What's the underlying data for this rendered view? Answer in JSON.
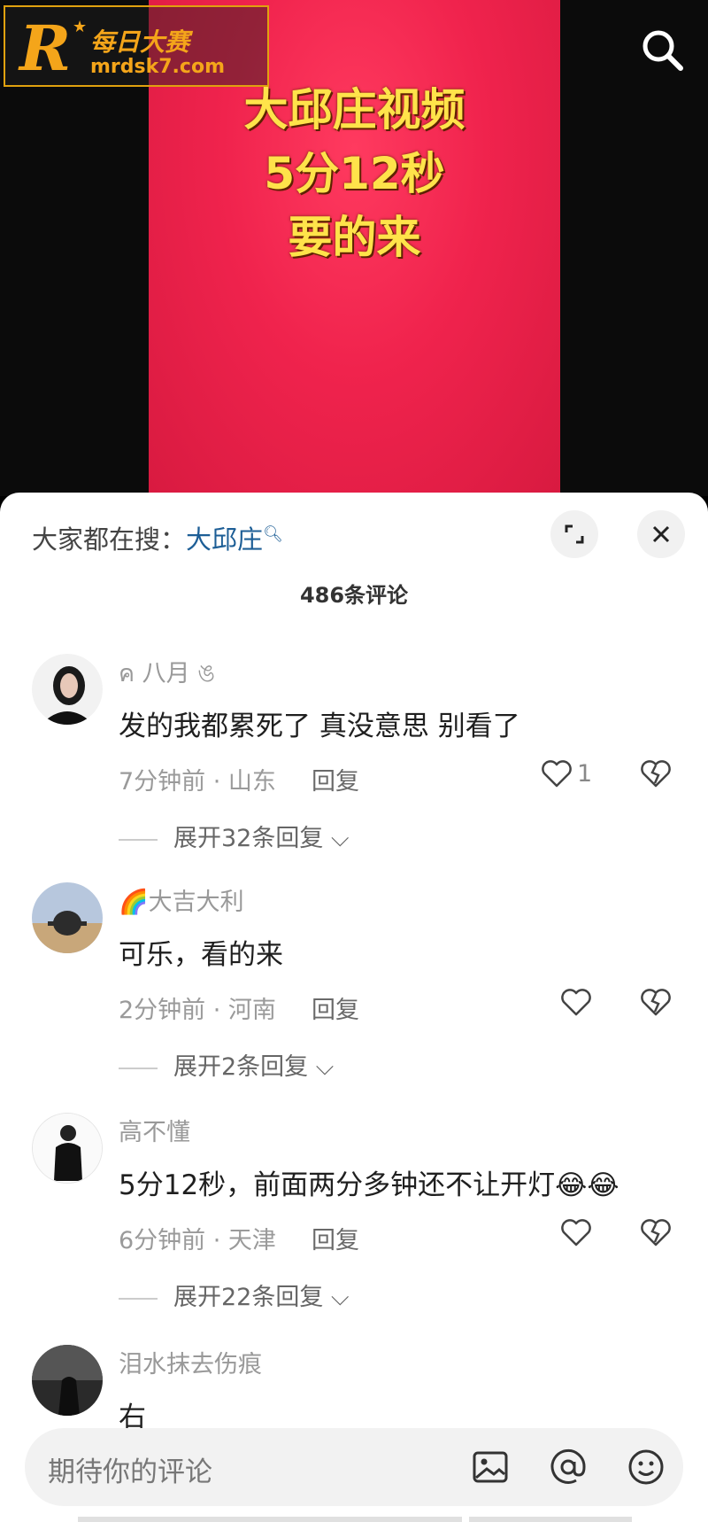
{
  "video": {
    "caption_lines": [
      "大邱庄视频",
      "5分12秒",
      "要的来"
    ],
    "bg_color": "#f0234d",
    "caption_color": "#ffe34a"
  },
  "watermark": {
    "logo_letter": "R",
    "name": "每日大赛",
    "url": "mrdsk7.com"
  },
  "panel": {
    "hot_search_label": "大家都在搜：",
    "hot_search_term": "大邱庄",
    "comment_count": "486条评论"
  },
  "comments": [
    {
      "username": "ค 八月 ঙ",
      "text": "发的我都累死了 真没意思 别看了",
      "time_location": "7分钟前 · 山东",
      "reply": "回复",
      "likes": "1",
      "expand": "展开32条回复"
    },
    {
      "username": "🌈大吉大利",
      "text": "可乐，看的来",
      "time_location": "2分钟前 · 河南",
      "reply": "回复",
      "likes": "",
      "expand": "展开2条回复"
    },
    {
      "username": "高不懂",
      "text": "5分12秒，前面两分多钟还不让开灯😂😂",
      "time_location": "6分钟前 · 天津",
      "reply": "回复",
      "likes": "",
      "expand": "展开22条回复"
    },
    {
      "username": "泪水抹去伤痕",
      "text": "右"
    }
  ],
  "input": {
    "placeholder": "期待你的评论"
  },
  "icons": [
    "search-icon",
    "expand-icon",
    "close-icon",
    "heart-icon",
    "dislike-heart-icon",
    "chevron-down-icon",
    "image-icon",
    "at-icon",
    "emoji-icon"
  ]
}
